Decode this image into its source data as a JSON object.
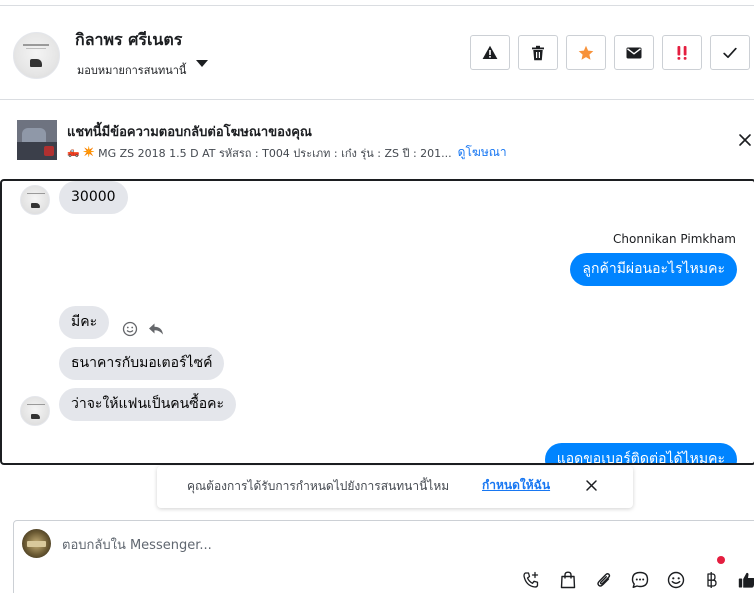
{
  "header": {
    "contact_name": "กิลาพร ศรีเนตร",
    "assign_label": "มอบหมายการสนทนานี้",
    "buttons": [
      {
        "name": "mark-spam-button",
        "icon": "warning-icon",
        "color": "#1c1e21"
      },
      {
        "name": "delete-button",
        "icon": "trash-icon",
        "color": "#1c1e21"
      },
      {
        "name": "follow-up-button",
        "icon": "star-icon",
        "color": "#f7923a"
      },
      {
        "name": "mark-unread-button",
        "icon": "envelope-icon",
        "color": "#1c1e21"
      },
      {
        "name": "priority-button",
        "icon": "double-exclamation-icon",
        "color": "#e41e3f"
      },
      {
        "name": "mark-done-button",
        "icon": "checkmark-icon",
        "color": "#1c1e21"
      }
    ]
  },
  "ad_banner": {
    "title": "แชทนี้มีข้อความตอบกลับต่อโฆษณาของคุณ",
    "emoji": "🛻 ✴️",
    "detail": "MG ZS 2018 1.5 D AT รหัสรถ : T004 ประเภท : เก๋ง รุ่น : ZS ปี : 201...",
    "link": "ดูโฆษณา"
  },
  "chat": {
    "messages": [
      {
        "id": "m1",
        "direction": "incoming",
        "text": "30000"
      },
      {
        "id": "m2",
        "direction": "outgoing",
        "sender": "Chonnikan Pimkham",
        "text": "ลูกค้ามีผ่อนอะไรไหมคะ"
      },
      {
        "id": "m3",
        "direction": "incoming",
        "text": "มีคะ"
      },
      {
        "id": "m4",
        "direction": "incoming",
        "text": "ธนาคารกับมอเตอร์ไซค์"
      },
      {
        "id": "m5",
        "direction": "incoming",
        "text": "ว่าจะให้แฟนเป็นคนซื้อคะ"
      },
      {
        "id": "m6",
        "direction": "outgoing",
        "text": "แอดขอเบอร์ติดต่อได้ไหมคะ"
      }
    ],
    "colors": {
      "incoming_bubble": "#e4e6eb",
      "outgoing_bubble": "#0084ff"
    }
  },
  "notice": {
    "text": "คุณต้องการได้รับการกำหนดไปยังการสนทนานี้ไหม",
    "link": "กำหนดให้ฉัน"
  },
  "composer": {
    "placeholder": "ตอบกลับใน Messenger...",
    "tools": [
      "call-add-icon",
      "shopping-bag-icon",
      "paperclip-icon",
      "chat-bubble-icon",
      "emoji-icon",
      "baht-icon",
      "thumbs-up-icon"
    ]
  }
}
